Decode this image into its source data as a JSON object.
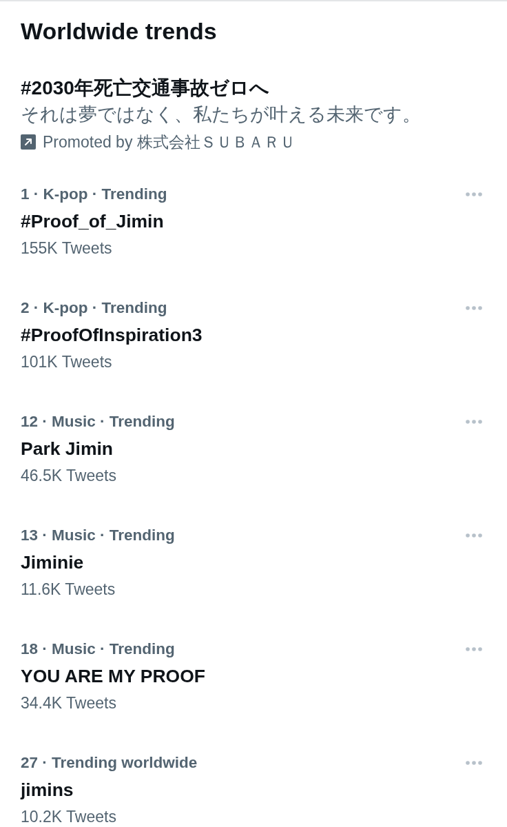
{
  "header": {
    "title": "Worldwide trends"
  },
  "promoted_trend": {
    "headline": "#2030年死亡交通事故ゼロへ",
    "description": "それは夢ではなく、私たちが叶える未来です。",
    "promoted_by": "Promoted by 株式会社ＳＵＢＡＲＵ"
  },
  "trends": [
    {
      "context": "1 · K-pop · Trending",
      "name": "#Proof_of_Jimin",
      "tweet_count": "155K Tweets"
    },
    {
      "context": "2 · K-pop · Trending",
      "name": "#ProofOfInspiration3",
      "tweet_count": "101K Tweets"
    },
    {
      "context": "12 · Music · Trending",
      "name": "Park Jimin",
      "tweet_count": "46.5K Tweets"
    },
    {
      "context": "13 · Music · Trending",
      "name": "Jiminie",
      "tweet_count": "11.6K Tweets"
    },
    {
      "context": "18 · Music · Trending",
      "name": "YOU ARE MY PROOF",
      "tweet_count": "34.4K Tweets"
    },
    {
      "context": "27 · Trending worldwide",
      "name": "jimins",
      "tweet_count": "10.2K Tweets"
    }
  ]
}
